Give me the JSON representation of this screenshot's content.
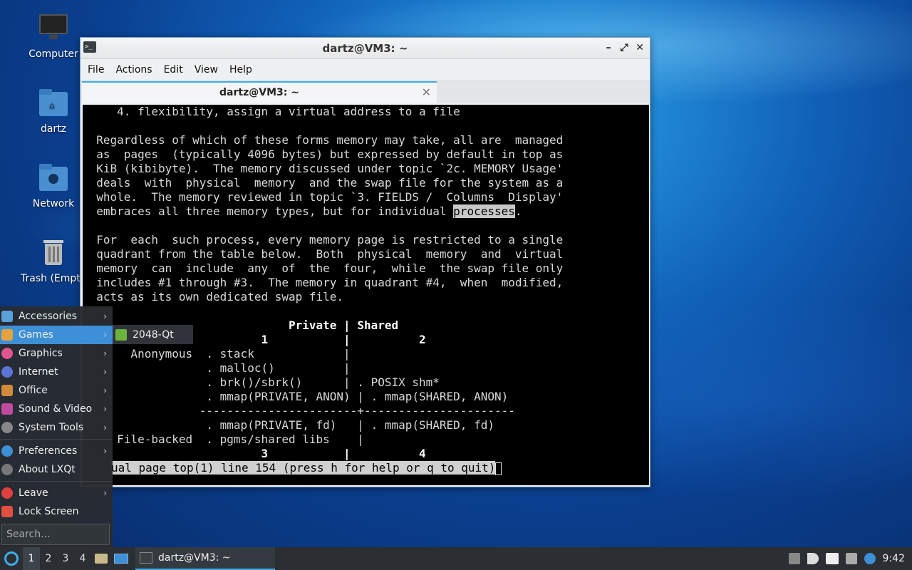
{
  "desktop": {
    "icons": [
      {
        "label": "Computer",
        "icon": "monitor-icon"
      },
      {
        "label": "dartz",
        "icon": "home-folder-icon"
      },
      {
        "label": "Network",
        "icon": "network-folder-icon"
      },
      {
        "label": "Trash (Empt",
        "icon": "trash-icon"
      }
    ]
  },
  "window": {
    "title": "dartz@VM3: ~",
    "controls": [
      "–",
      "⤢",
      "✕"
    ],
    "menu": [
      "File",
      "Actions",
      "Edit",
      "View",
      "Help"
    ],
    "tab": {
      "label": "dartz@VM3: ~",
      "close": "✕"
    }
  },
  "terminal": {
    "lines": [
      "     4. flexibility, assign a virtual address to a file",
      "",
      "  Regardless of which of these forms memory may take, all are  managed",
      "  as  pages  (typically 4096 bytes) but expressed by default in top as",
      "  KiB (kibibyte).  The memory discussed under topic `2c. MEMORY Usage'",
      "  deals  with  physical  memory  and the swap file for the system as a",
      "  whole.  The memory reviewed in topic `3. FIELDS /  Columns  Display'",
      "  embraces all three memory types, but for individual ",
      "",
      "  For  each  such process, every memory page is restricted to a single",
      "  quadrant from the table below.  Both  physical  memory  and  virtual",
      "  memory  can  include  any  of  the  four,  while  the swap file only",
      "  includes #1 through #3.  The memory in quadrant #4,  when  modified,",
      "  acts as its own dedicated swap file.",
      "",
      "                              Private | Shared",
      "                          1           |          2",
      "       Anonymous  . stack             |",
      "                  . malloc()          |",
      "                  . brk()/sbrk()      | . POSIX shm*",
      "                  . mmap(PRIVATE, ANON) | . mmap(SHARED, ANON)",
      "                 -----------------------+----------------------",
      "                  . mmap(PRIVATE, fd)   | . mmap(SHARED, fd)",
      "     File-backed  . pgms/shared libs    |",
      "                          3           |          4"
    ],
    "highlight_word": "processes",
    "line7_tail": ".",
    "status_line": "ual page top(1) line 154 (press h for help or q to quit)"
  },
  "start_menu": {
    "items": [
      {
        "label": "Accessories",
        "has_submenu": true,
        "icon": "accessories-icon",
        "color": "#5aa0d8"
      },
      {
        "label": "Games",
        "has_submenu": true,
        "icon": "games-icon",
        "color": "#e6a23c"
      },
      {
        "label": "Graphics",
        "has_submenu": true,
        "icon": "graphics-icon",
        "color": "#e0558a"
      },
      {
        "label": "Internet",
        "has_submenu": true,
        "icon": "internet-icon",
        "color": "#5a74d8"
      },
      {
        "label": "Office",
        "has_submenu": true,
        "icon": "office-icon",
        "color": "#d28a3a"
      },
      {
        "label": "Sound & Video",
        "has_submenu": true,
        "icon": "sound-video-icon",
        "color": "#c04aa0"
      },
      {
        "label": "System Tools",
        "has_submenu": true,
        "icon": "system-tools-icon",
        "color": "#888888"
      },
      {
        "label": "Preferences",
        "has_submenu": true,
        "icon": "preferences-icon",
        "color": "#3d8fd6"
      },
      {
        "label": "About LXQt",
        "has_submenu": false,
        "icon": "info-icon",
        "color": "#777777"
      },
      {
        "label": "Leave",
        "has_submenu": true,
        "icon": "power-icon",
        "color": "#e04040"
      },
      {
        "label": "Lock Screen",
        "has_submenu": false,
        "icon": "lock-icon",
        "color": "#e05040"
      }
    ],
    "search_placeholder": "Search...",
    "games_submenu": [
      "2048-Qt"
    ]
  },
  "taskbar": {
    "desktops": [
      "1",
      "2",
      "3",
      "4"
    ],
    "active_desktop": "1",
    "task_label": "dartz@VM3: ~",
    "clock": "9:42"
  }
}
